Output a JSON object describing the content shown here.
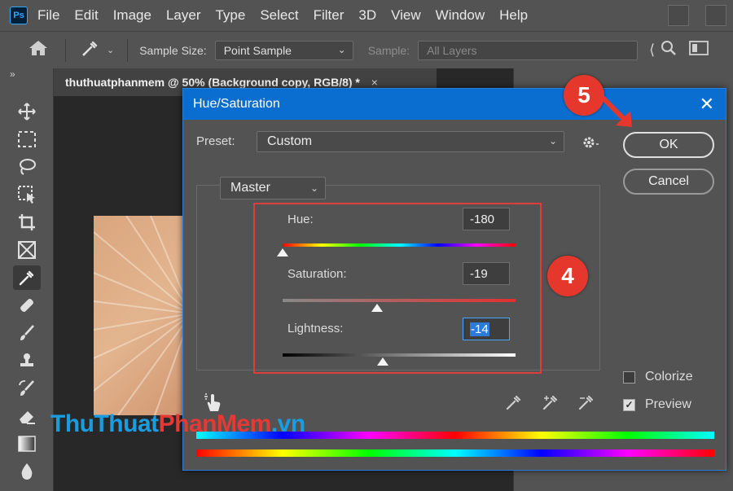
{
  "menubar": {
    "logo": "Ps",
    "items": [
      "File",
      "Edit",
      "Image",
      "Layer",
      "Type",
      "Select",
      "Filter",
      "3D",
      "View",
      "Window",
      "Help"
    ]
  },
  "options": {
    "sample_size_label": "Sample Size:",
    "sample_size_value": "Point Sample",
    "sample_label": "Sample:",
    "sample_value": "All Layers"
  },
  "document": {
    "tab_title": "thuthuatphanmem @ 50% (Background copy, RGB/8) *",
    "tab_close": "×"
  },
  "dialog": {
    "title": "Hue/Saturation",
    "close": "✕",
    "preset_label": "Preset:",
    "preset_value": "Custom",
    "channel_value": "Master",
    "ok_label": "OK",
    "cancel_label": "Cancel",
    "hue_label": "Hue:",
    "hue_value": "-180",
    "saturation_label": "Saturation:",
    "saturation_value": "-19",
    "lightness_label": "Lightness:",
    "lightness_value": "-14",
    "colorize_label": "Colorize",
    "colorize_checked": false,
    "preview_label": "Preview",
    "preview_checked": true,
    "hue_level": -180,
    "saturation_level": -19,
    "lightness_level": -14
  },
  "annotations": {
    "step4": "4",
    "step5": "5"
  },
  "watermark": {
    "part1": "ThuThuat",
    "part2": "PhanMem",
    "part3": ".vn",
    "color1": "#1a9de0",
    "color2": "#e53935"
  },
  "colors": {
    "accent": "#0a6ed1",
    "highlight": "#e03c3c"
  }
}
